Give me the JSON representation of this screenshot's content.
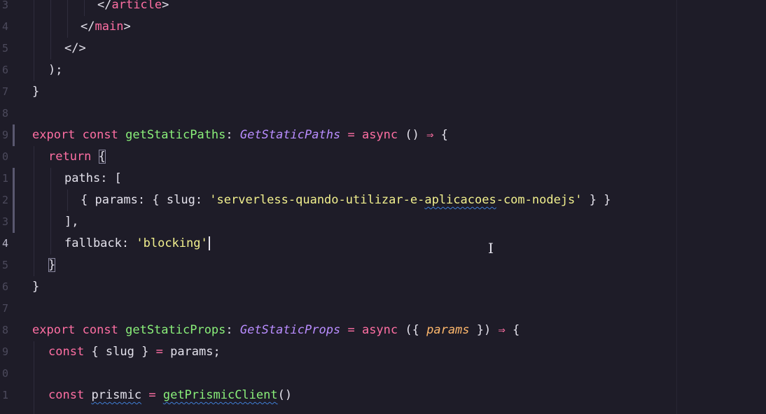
{
  "editor": {
    "language": "typescript-react",
    "colors": {
      "background": "#1e1c28",
      "keyword": "#ff6fa3",
      "function": "#8af07a",
      "type": "#b98dff",
      "string": "#f2f08e",
      "parameter": "#ffb86c"
    },
    "line_numbers": [
      "3",
      "4",
      "5",
      "6",
      "7",
      "8",
      "9",
      "0",
      "1",
      "2",
      "3",
      "4",
      "5",
      "6",
      "7",
      "8",
      "9",
      "0",
      "1"
    ],
    "active_line_number": "4",
    "lines": {
      "l0": {
        "close_tag_open": "</",
        "tag": "article",
        "close_tag_end": ">"
      },
      "l1": {
        "close_tag_open": "</",
        "tag": "main",
        "close_tag_end": ">"
      },
      "l2": {
        "fragment": "</>"
      },
      "l3": {
        "text": ");"
      },
      "l4": {
        "text": "}"
      },
      "l6": {
        "kw_export": "export",
        "kw_const": "const",
        "fn_name": "getStaticPaths",
        "colon": ":",
        "type_name": "GetStaticPaths",
        "eq": "=",
        "kw_async": "async",
        "parens": "()",
        "arrow": "⇒",
        "brace": "{"
      },
      "l7": {
        "kw_return": "return",
        "brace": "{"
      },
      "l8": {
        "prop": "paths",
        "rest": ": ["
      },
      "l9": {
        "open": "{ ",
        "prop_params": "params",
        "mid": ": { ",
        "prop_slug": "slug",
        "colon": ": ",
        "string_start": "'serverless-quando-utilizar-e-",
        "string_squiggle": "aplicacoes",
        "string_end": "-com-nodejs'",
        "close": " } }"
      },
      "l10": {
        "text": "],"
      },
      "l11": {
        "prop": "fallback",
        "colon": ": ",
        "string": "'blocking'"
      },
      "l12": {
        "brace": "}"
      },
      "l13": {
        "text": "}"
      },
      "l15": {
        "kw_export": "export",
        "kw_const": "const",
        "fn_name": "getStaticProps",
        "colon": ":",
        "type_name": "GetStaticProps",
        "eq": "=",
        "kw_async": "async",
        "open": "({ ",
        "param": "params",
        "close": " })",
        "arrow": "⇒",
        "brace": "{"
      },
      "l16": {
        "kw_const": "const",
        "destructure": "{ slug }",
        "eq": "=",
        "value": "params;"
      },
      "l18": {
        "kw_const": "const",
        "var_name": "prismic",
        "eq": "=",
        "fn_call": "getPrismicClient",
        "parens": "()"
      }
    }
  }
}
